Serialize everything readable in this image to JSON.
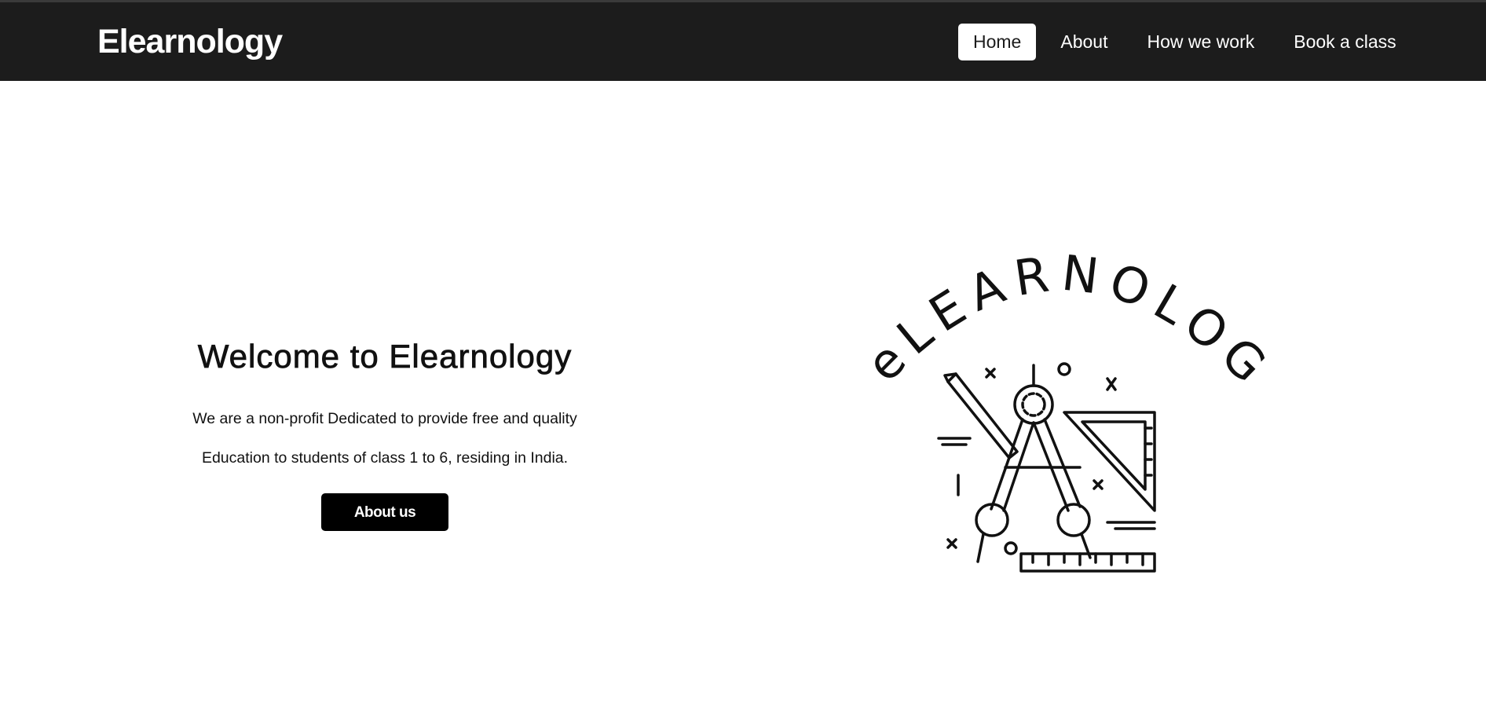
{
  "header": {
    "brand": "Elearnology",
    "nav": [
      {
        "label": "Home",
        "active": true
      },
      {
        "label": "About",
        "active": false
      },
      {
        "label": "How we work",
        "active": false
      },
      {
        "label": "Book a class",
        "active": false
      }
    ]
  },
  "hero": {
    "title": "Welcome to Elearnology",
    "line1": "We are a non-profit Dedicated to provide free and quality",
    "line2": "Education to students of class 1 to 6, residing in India.",
    "button_label": "About us"
  },
  "logo": {
    "arc_text": "eLEARNOLOGY",
    "icon": "drafting-tools-illustration"
  },
  "colors": {
    "navbar": "#1c1c1c",
    "button": "#000000",
    "text": "#111111"
  }
}
